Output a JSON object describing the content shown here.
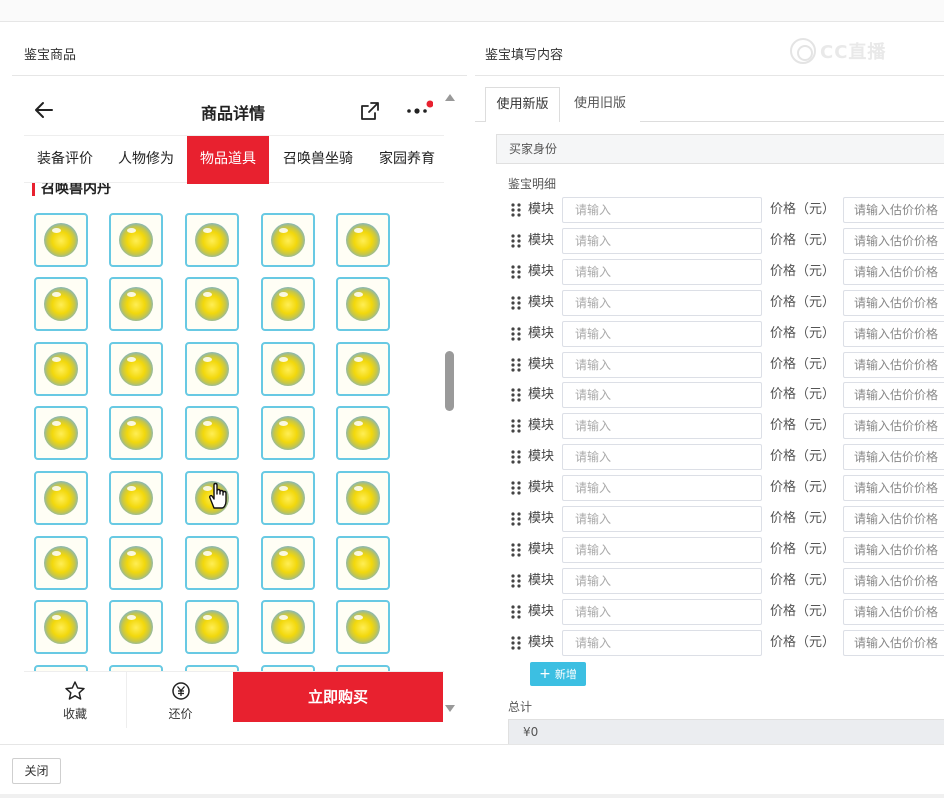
{
  "panels": {
    "left_title": "鉴宝商品",
    "right_title": "鉴宝填写内容"
  },
  "watermark": {
    "text": "CC直播"
  },
  "phone": {
    "title": "商品详情",
    "icons": {
      "back": "arrow-left-icon",
      "share": "share-icon",
      "more": "more-dots-icon",
      "notification_color": "#e8212f"
    },
    "tabs": [
      {
        "label": "装备评价",
        "active": false
      },
      {
        "label": "人物修为",
        "active": false
      },
      {
        "label": "物品道具",
        "active": true
      },
      {
        "label": "召唤兽坐骑",
        "active": false
      },
      {
        "label": "家园养育",
        "active": false
      }
    ],
    "section_title": "召唤兽内丹",
    "item_icon": "pill-orb-icon",
    "bottom": {
      "favorite_label": "收藏",
      "bargain_label": "还价",
      "buy_label": "立即购买"
    }
  },
  "form": {
    "tabs": {
      "new": "使用新版",
      "old": "使用旧版"
    },
    "buyer_identity": "买家身份",
    "detail_label": "鉴宝明细",
    "rows": [
      {
        "module_label": "模块",
        "module_placeholder": "请输入",
        "price_label": "价格（元）",
        "price_placeholder": "请输入估价价格"
      },
      {
        "module_label": "模块",
        "module_placeholder": "请输入",
        "price_label": "价格（元）",
        "price_placeholder": "请输入估价价格"
      },
      {
        "module_label": "模块",
        "module_placeholder": "请输入",
        "price_label": "价格（元）",
        "price_placeholder": "请输入估价价格"
      },
      {
        "module_label": "模块",
        "module_placeholder": "请输入",
        "price_label": "价格（元）",
        "price_placeholder": "请输入估价价格"
      },
      {
        "module_label": "模块",
        "module_placeholder": "请输入",
        "price_label": "价格（元）",
        "price_placeholder": "请输入估价价格"
      },
      {
        "module_label": "模块",
        "module_placeholder": "请输入",
        "price_label": "价格（元）",
        "price_placeholder": "请输入估价价格"
      },
      {
        "module_label": "模块",
        "module_placeholder": "请输入",
        "price_label": "价格（元）",
        "price_placeholder": "请输入估价价格"
      },
      {
        "module_label": "模块",
        "module_placeholder": "请输入",
        "price_label": "价格（元）",
        "price_placeholder": "请输入估价价格"
      },
      {
        "module_label": "模块",
        "module_placeholder": "请输入",
        "price_label": "价格（元）",
        "price_placeholder": "请输入估价价格"
      },
      {
        "module_label": "模块",
        "module_placeholder": "请输入",
        "price_label": "价格（元）",
        "price_placeholder": "请输入估价价格"
      },
      {
        "module_label": "模块",
        "module_placeholder": "请输入",
        "price_label": "价格（元）",
        "price_placeholder": "请输入估价价格"
      },
      {
        "module_label": "模块",
        "module_placeholder": "请输入",
        "price_label": "价格（元）",
        "price_placeholder": "请输入估价价格"
      },
      {
        "module_label": "模块",
        "module_placeholder": "请输入",
        "price_label": "价格（元）",
        "price_placeholder": "请输入估价价格"
      },
      {
        "module_label": "模块",
        "module_placeholder": "请输入",
        "price_label": "价格（元）",
        "price_placeholder": "请输入估价价格"
      },
      {
        "module_label": "模块",
        "module_placeholder": "请输入",
        "price_label": "价格（元）",
        "price_placeholder": "请输入估价价格"
      }
    ],
    "add_label": "新增",
    "total_label": "总计",
    "total_value": "¥0"
  },
  "footer": {
    "close_label": "关闭"
  },
  "colors": {
    "accent_red": "#e8212f",
    "accent_cyan": "#3cbfe2",
    "item_border": "#68c9e3"
  }
}
